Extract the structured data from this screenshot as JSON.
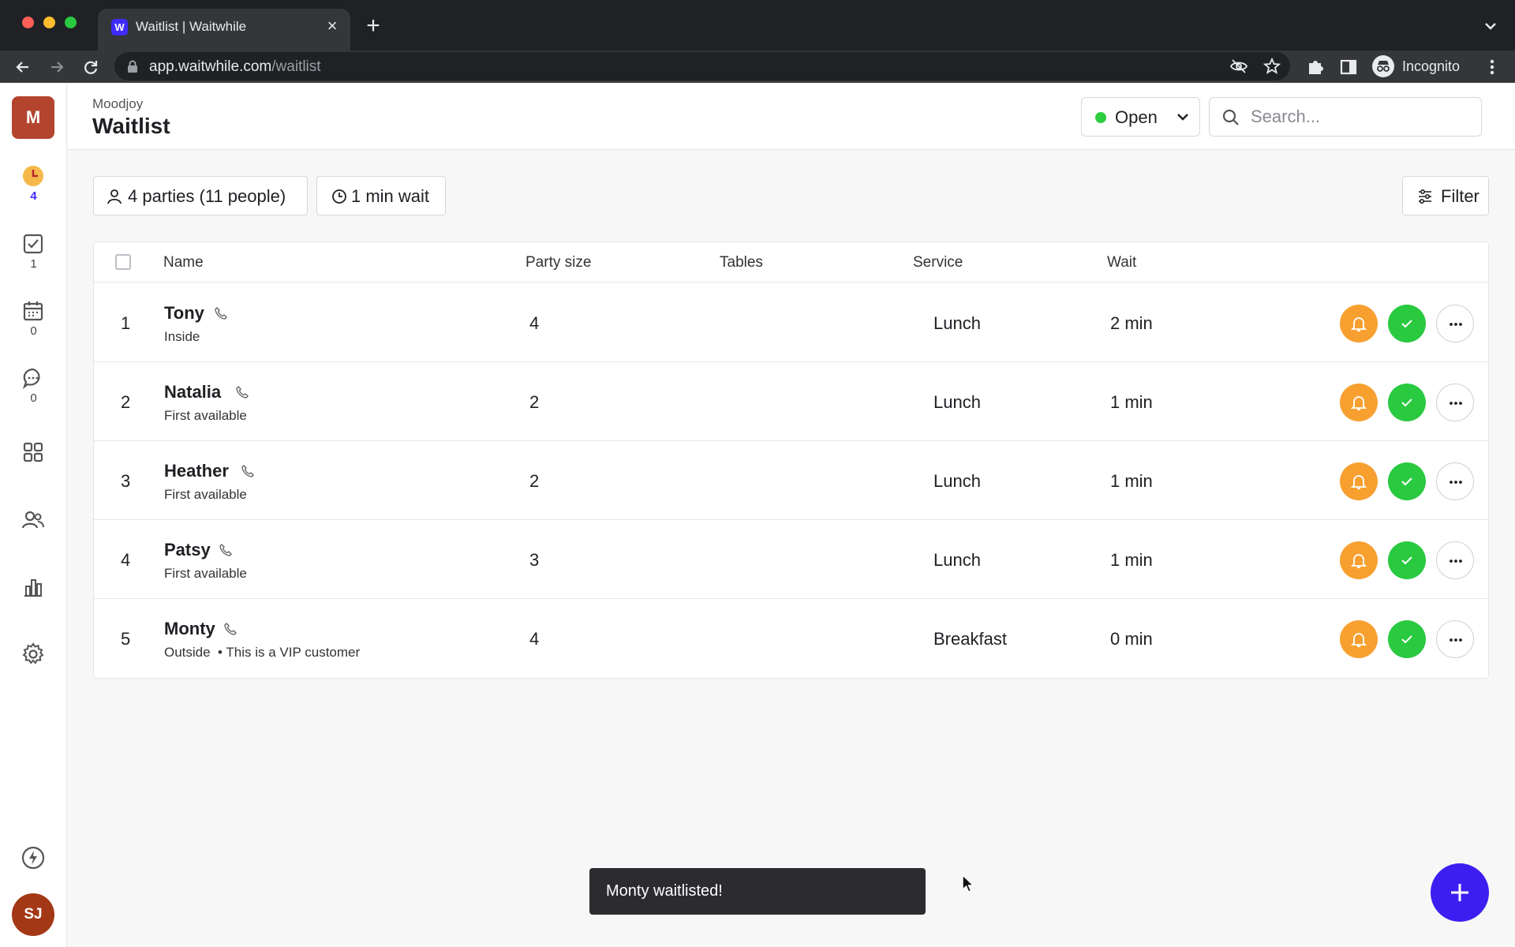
{
  "browser": {
    "tab_title": "Waitlist | Waitwhile",
    "tab_favicon": "W",
    "url_host": "app.waitwhile.com",
    "url_path": "/waitlist",
    "profile_label": "Incognito",
    "icons": [
      "back-icon",
      "forward-icon",
      "reload-icon",
      "lock-icon",
      "eye-off-icon",
      "star-icon",
      "puzzle-icon",
      "sidepanel-icon",
      "incognito-icon",
      "kebab-icon"
    ]
  },
  "sidebar": {
    "workspace_initial": "M",
    "nav": [
      {
        "icon": "clock-icon",
        "count": "4",
        "active": true
      },
      {
        "icon": "check-square-icon",
        "count": "1"
      },
      {
        "icon": "calendar-icon",
        "count": "0"
      },
      {
        "icon": "chat-icon",
        "count": "0"
      },
      {
        "icon": "grid-icon"
      },
      {
        "icon": "users-icon"
      },
      {
        "icon": "bar-chart-icon"
      },
      {
        "icon": "gear-icon"
      },
      {
        "icon": "bolt-icon"
      }
    ],
    "user_initials": "SJ"
  },
  "header": {
    "org_name": "Moodjoy",
    "title": "Waitlist",
    "status_label": "Open",
    "status_color": "#2ecc40",
    "search_placeholder": "Search..."
  },
  "summary": {
    "parties_label": "4 parties (11 people)",
    "wait_label": "1 min wait",
    "filter_label": "Filter"
  },
  "table": {
    "columns": [
      "Name",
      "Party size",
      "Tables",
      "Service",
      "Wait"
    ],
    "rows": [
      {
        "rank": "1",
        "name": "Tony",
        "note": "Inside",
        "party_size": "4",
        "tables": "",
        "service": "Lunch",
        "wait": "2 min"
      },
      {
        "rank": "2",
        "name": "Natalia",
        "note": "First available",
        "party_size": "2",
        "tables": "",
        "service": "Lunch",
        "wait": "1 min"
      },
      {
        "rank": "3",
        "name": "Heather",
        "note": "First available",
        "party_size": "2",
        "tables": "",
        "service": "Lunch",
        "wait": "1 min"
      },
      {
        "rank": "4",
        "name": "Patsy",
        "note": "First available",
        "party_size": "3",
        "tables": "",
        "service": "Lunch",
        "wait": "1 min"
      },
      {
        "rank": "5",
        "name": "Monty",
        "note": "Outside  • This is a VIP customer",
        "party_size": "4",
        "tables": "",
        "service": "Breakfast",
        "wait": "0 min"
      }
    ]
  },
  "colors": {
    "accent": "#3d1ef0",
    "notify": "#f7a030",
    "seat": "#29c940"
  },
  "toast": {
    "text": "Monty waitlisted!"
  }
}
